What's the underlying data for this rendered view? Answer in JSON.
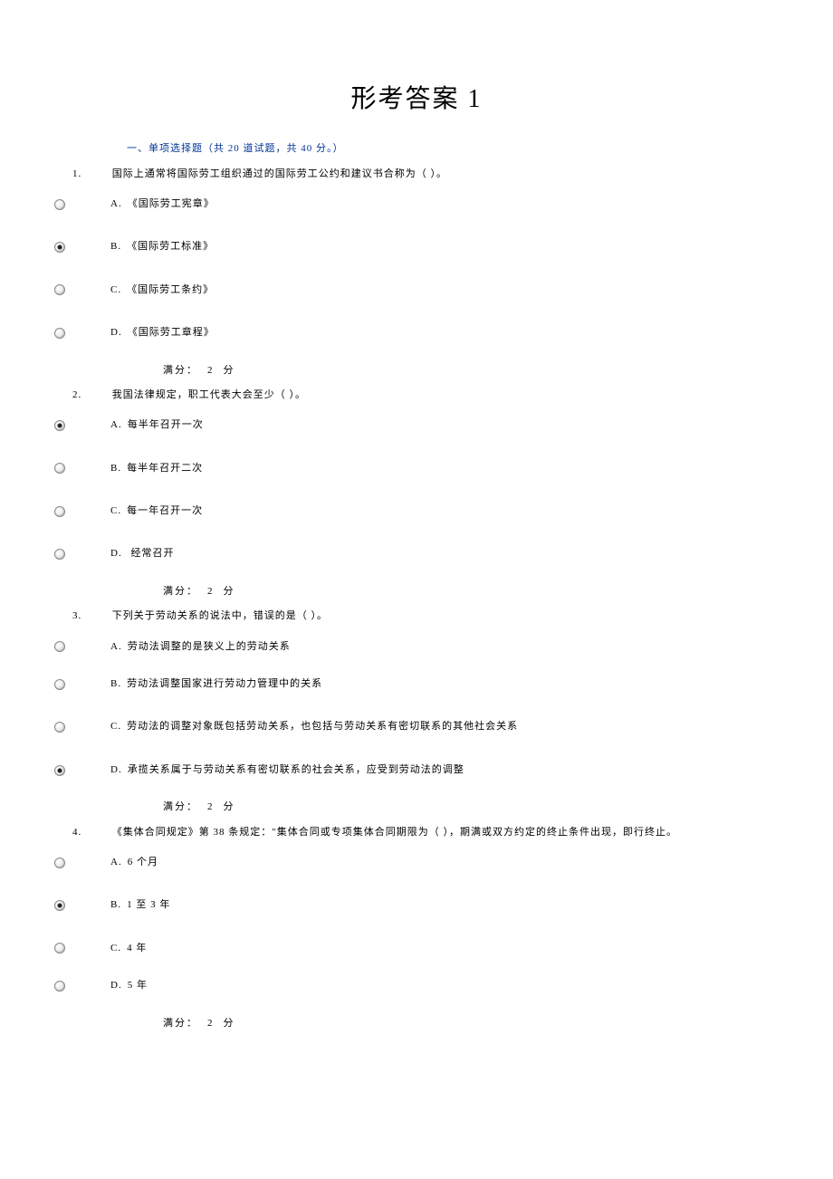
{
  "page_title": "形考答案 1",
  "section_header": "一、单项选择题（共  20  道试题，共  40  分。）",
  "marks_label_a": "满分：",
  "marks_value": "2",
  "marks_label_b": "分",
  "questions": [
    {
      "num": "1.",
      "text": "国际上通常将国际劳工组织通过的国际劳工公约和建议书合称为（  ）。",
      "options": [
        {
          "letter": "A.",
          "label": "《国际劳工宪章》",
          "selected": false
        },
        {
          "letter": "B.",
          "label": "《国际劳工标准》",
          "selected": true
        },
        {
          "letter": "C.",
          "label": "《国际劳工条约》",
          "selected": false
        },
        {
          "letter": "D.",
          "label": "《国际劳工章程》",
          "selected": false
        }
      ]
    },
    {
      "num": "2.",
      "text": "我国法律规定，职工代表大会至少（  ）。",
      "options": [
        {
          "letter": "A.",
          "label": "每半年召开一次",
          "selected": true
        },
        {
          "letter": "B.",
          "label": "每半年召开二次",
          "selected": false
        },
        {
          "letter": "C.",
          "label": "每一年召开一次",
          "selected": false
        },
        {
          "letter": "D.",
          "label": " 经常召开",
          "selected": false
        }
      ]
    },
    {
      "num": "3.",
      "text": "下列关于劳动关系的说法中，错误的是（  ）。",
      "options": [
        {
          "letter": "A.",
          "label": "劳动法调整的是狭义上的劳动关系",
          "selected": false
        },
        {
          "letter": "B.",
          "label": "劳动法调整国家进行劳动力管理中的关系",
          "selected": false
        },
        {
          "letter": "C.",
          "label": "劳动法的调整对象既包括劳动关系，也包括与劳动关系有密切联系的其他社会关系",
          "selected": false
        },
        {
          "letter": "D.",
          "label": "承揽关系属于与劳动关系有密切联系的社会关系，应受到劳动法的调整",
          "selected": true
        }
      ]
    },
    {
      "num": "4.",
      "text": "《集体合同规定》第 38 条规定：\"集体合同或专项集体合同期限为（   ），期满或双方约定的终止条件出现，即行终止。",
      "options": [
        {
          "letter": "A.",
          "label": "6 个月",
          "selected": false
        },
        {
          "letter": "B.",
          "label": "1 至 3 年",
          "selected": true
        },
        {
          "letter": "C.",
          "label": "4 年",
          "selected": false
        },
        {
          "letter": "D.",
          "label": "5 年",
          "selected": false
        }
      ]
    }
  ]
}
